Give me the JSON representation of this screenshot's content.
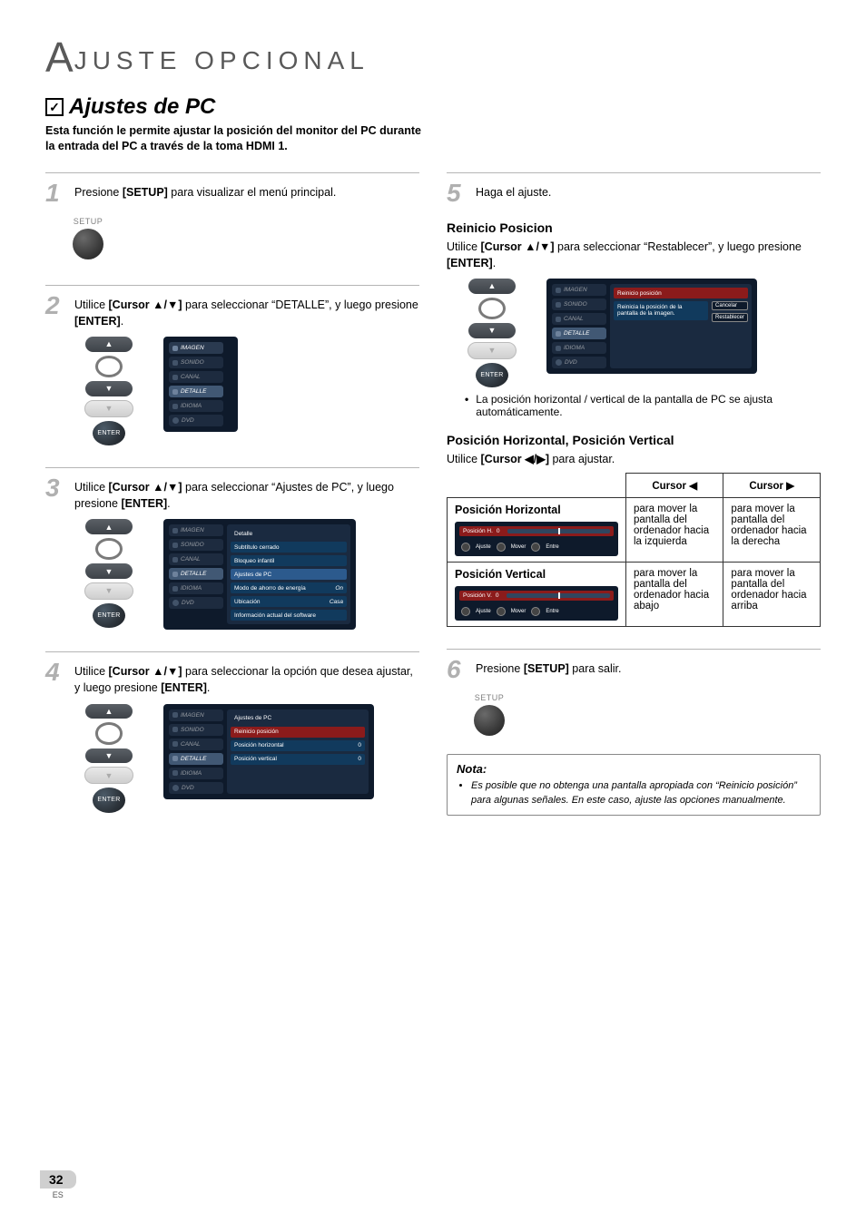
{
  "pageNumber": "32",
  "pageNumberSub": "ES",
  "mainTitle": {
    "first": "A",
    "rest": "JUSTE  OPCIONAL"
  },
  "section": {
    "title": "Ajustes de PC",
    "lead": "Esta función le permite ajustar la posición del monitor del PC durante la entrada del PC a través de la toma HDMI 1."
  },
  "setupLabel": "SETUP",
  "enterLabel": "ENTER",
  "tvTabs": [
    "IMAGEN",
    "SONIDO",
    "CANAL",
    "DETALLE",
    "IDIOMA",
    "DVD"
  ],
  "left": {
    "step1": {
      "pre": "Presione ",
      "bold": "[SETUP]",
      "post": " para visualizar el menú principal."
    },
    "step2": {
      "pre": "Utilice ",
      "bold": "[Cursor ▲/▼]",
      "post": " para seleccionar “DETALLE”, y luego presione ",
      "bold2": "[ENTER]",
      "post2": "."
    },
    "step3": {
      "pre": "Utilice ",
      "bold": "[Cursor ▲/▼]",
      "post": " para seleccionar “Ajustes de PC”, y luego presione ",
      "bold2": "[ENTER]",
      "post2": "."
    },
    "step4": {
      "pre": "Utilice ",
      "bold": "[Cursor ▲/▼]",
      "post": " para seleccionar la opción que desea ajustar, y luego presione ",
      "bold2": "[ENTER]",
      "post2": "."
    },
    "detallePanel": {
      "title": "Detalle",
      "rows": [
        {
          "label": "Subtítulo cerrado",
          "value": ""
        },
        {
          "label": "Bloqueo infantil",
          "value": ""
        },
        {
          "label": "Ajustes de PC",
          "value": "",
          "hl": true
        },
        {
          "label": "Modo de ahorro de energía",
          "value": "On"
        },
        {
          "label": "Ubicación",
          "value": "Casa"
        },
        {
          "label": "Información actual del software",
          "value": ""
        }
      ]
    },
    "ajustesPanel": {
      "title": "Ajustes de PC",
      "rows": [
        {
          "label": "Reinicio posición",
          "value": "",
          "red": true
        },
        {
          "label": "Posición horizontal",
          "value": "0"
        },
        {
          "label": "Posición vertical",
          "value": "0"
        }
      ]
    }
  },
  "right": {
    "step5": "Haga el ajuste.",
    "reinicio": {
      "title": "Reinicio Posicion",
      "text1": "Utilice ",
      "bold1": "[Cursor ▲/▼]",
      "text2": " para seleccionar “Restablecer”, y luego presione ",
      "bold2": "[ENTER]",
      "text3": "."
    },
    "reinicioPanel": {
      "title": "Reinicio posición",
      "desc": "Reinicia la posición de la pantalla de la imagen.",
      "buttons": [
        "Cancelar",
        "Restablecer"
      ]
    },
    "bullet": "La posición horizontal / vertical de la pantalla de PC se ajusta automáticamente.",
    "posTitle": "Posición Horizontal, Posición Vertical",
    "posText": {
      "pre": "Utilice ",
      "bold": "[Cursor ◀/▶]",
      "post": " para ajustar."
    },
    "table": {
      "headLeft": "Cursor ◀",
      "headRight": "Cursor ▶",
      "rows": [
        {
          "label": "Posición Horizontal",
          "barLabel": "Posición H.",
          "barVal": "0",
          "legend": [
            "Ajuste",
            "Mover",
            "Entre"
          ],
          "left": "para mover la pantalla del ordenador hacia la izquierda",
          "right": "para mover la pantalla del ordenador hacia la derecha"
        },
        {
          "label": "Posición Vertical",
          "barLabel": "Posición V.",
          "barVal": "0",
          "legend": [
            "Ajuste",
            "Mover",
            "Entre"
          ],
          "left": "para mover la pantalla del ordenador hacia abajo",
          "right": "para mover la pantalla del ordenador hacia arriba"
        }
      ]
    },
    "step6": {
      "pre": "Presione ",
      "bold": "[SETUP]",
      "post": " para salir."
    },
    "notaTitle": "Nota:",
    "notaItem": "Es posible que no obtenga una pantalla apropiada con “Reinicio posición” para algunas señales. En este caso, ajuste las opciones manualmente."
  }
}
